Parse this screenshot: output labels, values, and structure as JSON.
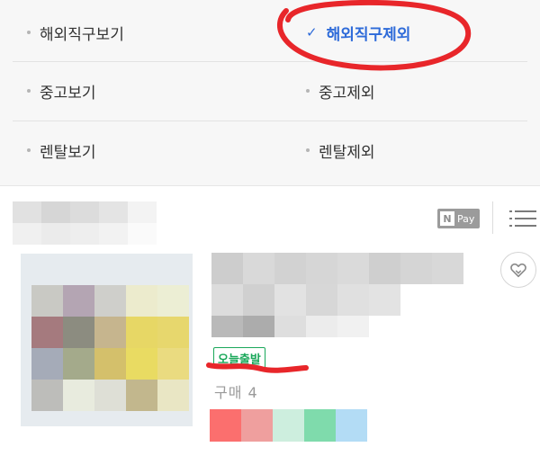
{
  "filters": {
    "left": [
      "해외직구보기",
      "중고보기",
      "렌탈보기"
    ],
    "right": [
      "해외직구제외",
      "중고제외",
      "렌탈제외"
    ],
    "selected_check": "✓"
  },
  "npay": {
    "n": "N",
    "pay": "Pay"
  },
  "product": {
    "badge": "오늘출발",
    "buy_count": "구매 4"
  },
  "colors": {
    "accent_blue": "#2e6bd9",
    "badge_green": "#1aa85a",
    "annotation_red": "#e8262a"
  },
  "icons": [
    "check-icon",
    "npay-icon",
    "list-view-icon",
    "wishlist-heart-icon"
  ]
}
